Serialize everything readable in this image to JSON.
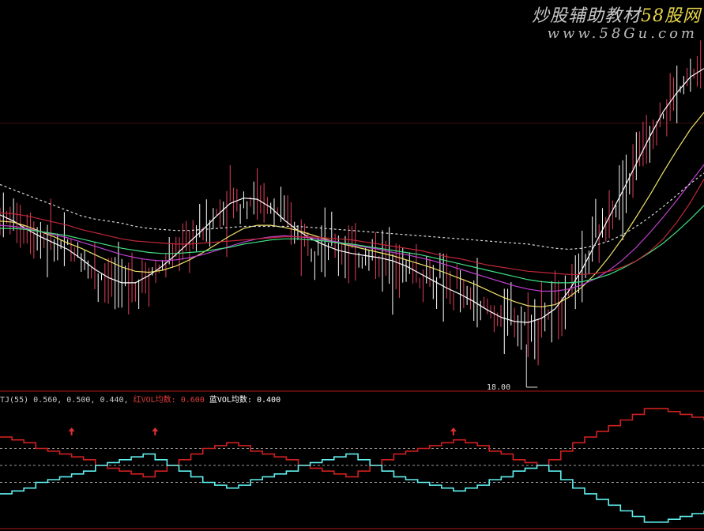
{
  "watermark": {
    "title_prefix": "炒股辅助教材",
    "title_brand": "58股网",
    "url": "www.58Gu.com"
  },
  "indicator": {
    "name": "TJ(55)",
    "values": "0.560, 0.500, 0.440,",
    "red_label": "红VOL均数:",
    "red_value": "0.600",
    "blue_label": "蓝VOL均数:",
    "blue_value": "0.400"
  },
  "colors": {
    "background": "#000000",
    "up_candle": "#ffffff",
    "down_candle": "#e0405e",
    "ma5": "#ffffff",
    "ma10": "#f0e26a",
    "ma20": "#c040d0",
    "ma30": "#40e080",
    "ma60": "#c02838",
    "ma120": "#d8d8d8",
    "indicator_red": "#d02020",
    "indicator_cyan": "#60f0f0",
    "panel_border": "#b01818"
  },
  "chart_data": [
    {
      "type": "candlestick",
      "low_label": "18.00",
      "grid": "horizontal",
      "series": [
        {
          "key": "ma5",
          "values": [
            31.6,
            31.0,
            30.2,
            29.5,
            28.9,
            28.3,
            27.4,
            26.4,
            25.6,
            25.1,
            25.1,
            25.8,
            26.7,
            27.8,
            29.0,
            30.2,
            31.5,
            32.7,
            33.2,
            33.1,
            32.3,
            31.1,
            30.1,
            29.3,
            28.7,
            28.2,
            27.9,
            27.7,
            27.5,
            27.2,
            26.7,
            26.0,
            25.3,
            24.6,
            24.0,
            23.3,
            22.5,
            21.8,
            21.4,
            21.3,
            21.7,
            22.6,
            24.3,
            26.4,
            28.9,
            31.4,
            33.9,
            36.5,
            39.1,
            41.5,
            43.3,
            44.8,
            45.6
          ]
        },
        {
          "key": "ma10",
          "values": [
            31.0,
            30.9,
            30.5,
            30.0,
            29.5,
            28.9,
            28.4,
            27.8,
            27.2,
            26.6,
            26.2,
            26.1,
            26.3,
            26.7,
            27.3,
            28.0,
            28.8,
            29.6,
            30.3,
            30.6,
            30.6,
            30.4,
            30.1,
            29.7,
            29.3,
            28.9,
            28.6,
            28.3,
            28.0,
            27.7,
            27.3,
            26.9,
            26.5,
            26.0,
            25.5,
            25.0,
            24.4,
            23.8,
            23.3,
            22.9,
            22.8,
            23.0,
            23.7,
            24.7,
            26.0,
            27.6,
            29.4,
            31.4,
            33.5,
            35.7,
            37.8,
            39.8,
            41.4
          ]
        },
        {
          "key": "ma20",
          "values": [
            30.6,
            30.5,
            30.3,
            30.0,
            29.7,
            29.4,
            29.0,
            28.6,
            28.2,
            27.8,
            27.5,
            27.3,
            27.2,
            27.3,
            27.5,
            27.8,
            28.2,
            28.6,
            29.0,
            29.3,
            29.5,
            29.6,
            29.5,
            29.4,
            29.2,
            29.0,
            28.7,
            28.5,
            28.3,
            28.0,
            27.8,
            27.5,
            27.2,
            26.8,
            26.4,
            26.0,
            25.6,
            25.2,
            24.8,
            24.5,
            24.3,
            24.3,
            24.5,
            24.9,
            25.5,
            26.3,
            27.3,
            28.5,
            29.9,
            31.4,
            33.0,
            34.7,
            36.4
          ]
        },
        {
          "key": "ma30",
          "values": [
            30.3,
            30.3,
            30.2,
            30.0,
            29.8,
            29.6,
            29.3,
            29.0,
            28.7,
            28.4,
            28.2,
            28.0,
            27.9,
            27.9,
            28.0,
            28.1,
            28.3,
            28.5,
            28.8,
            29.0,
            29.2,
            29.3,
            29.3,
            29.2,
            29.1,
            28.9,
            28.8,
            28.6,
            28.4,
            28.2,
            28.0,
            27.8,
            27.5,
            27.2,
            26.9,
            26.6,
            26.3,
            26.0,
            25.7,
            25.4,
            25.2,
            25.1,
            25.1,
            25.2,
            25.5,
            25.9,
            26.5,
            27.2,
            28.0,
            28.9,
            30.0,
            31.2,
            32.5
          ]
        },
        {
          "key": "ma60",
          "values": [
            31.8,
            31.7,
            31.5,
            31.2,
            30.9,
            30.6,
            30.2,
            29.9,
            29.6,
            29.3,
            29.1,
            29.0,
            28.9,
            28.8,
            28.8,
            28.9,
            29.0,
            29.1,
            29.2,
            29.3,
            29.4,
            29.5,
            29.5,
            29.5,
            29.4,
            29.3,
            29.2,
            29.0,
            28.8,
            28.6,
            28.4,
            28.2,
            27.9,
            27.6,
            27.4,
            27.1,
            26.8,
            26.6,
            26.4,
            26.2,
            26.1,
            26.0,
            25.9,
            25.9,
            26.0,
            26.2,
            26.6,
            27.2,
            28.1,
            29.3,
            30.9,
            32.8,
            35.0
          ]
        },
        {
          "key": "ma120",
          "values": [
            34.5,
            34.0,
            33.5,
            33.0,
            32.5,
            32.0,
            31.5,
            31.2,
            31.0,
            30.8,
            30.5,
            30.3,
            30.2,
            30.1,
            30.1,
            30.2,
            30.3,
            30.4,
            30.5,
            30.5,
            30.5,
            30.5,
            30.5,
            30.4,
            30.3,
            30.2,
            30.1,
            30.0,
            29.9,
            29.8,
            29.7,
            29.6,
            29.5,
            29.4,
            29.3,
            29.2,
            29.1,
            29.0,
            28.9,
            28.8,
            28.6,
            28.4,
            28.3,
            28.4,
            28.7,
            29.1,
            29.7,
            30.5,
            31.4,
            32.4,
            33.5,
            34.6,
            35.6
          ]
        }
      ]
    },
    {
      "type": "line",
      "name": "TJ(55)",
      "levels": [
        0.56,
        0.5,
        0.44
      ],
      "series": [
        {
          "key": "red",
          "name": "红VOL均数",
          "values": [
            0.6,
            0.59,
            0.58,
            0.56,
            0.55,
            0.54,
            0.53,
            0.52,
            0.5,
            0.49,
            0.48,
            0.47,
            0.46,
            0.48,
            0.5,
            0.52,
            0.54,
            0.56,
            0.57,
            0.58,
            0.57,
            0.55,
            0.54,
            0.53,
            0.52,
            0.5,
            0.49,
            0.48,
            0.47,
            0.46,
            0.48,
            0.5,
            0.52,
            0.54,
            0.55,
            0.56,
            0.57,
            0.58,
            0.59,
            0.58,
            0.57,
            0.55,
            0.54,
            0.52,
            0.51,
            0.5,
            0.52,
            0.55,
            0.58,
            0.6,
            0.62,
            0.64,
            0.66,
            0.68,
            0.7,
            0.7,
            0.69,
            0.68,
            0.67,
            0.66
          ]
        },
        {
          "key": "cyan",
          "name": "蓝VOL均数",
          "values": [
            0.4,
            0.41,
            0.42,
            0.44,
            0.45,
            0.46,
            0.47,
            0.48,
            0.5,
            0.51,
            0.52,
            0.53,
            0.54,
            0.52,
            0.5,
            0.48,
            0.46,
            0.44,
            0.43,
            0.42,
            0.43,
            0.45,
            0.46,
            0.47,
            0.48,
            0.5,
            0.51,
            0.52,
            0.53,
            0.54,
            0.52,
            0.5,
            0.48,
            0.46,
            0.45,
            0.44,
            0.43,
            0.42,
            0.41,
            0.42,
            0.43,
            0.45,
            0.46,
            0.48,
            0.49,
            0.5,
            0.48,
            0.45,
            0.42,
            0.4,
            0.38,
            0.36,
            0.34,
            0.32,
            0.3,
            0.3,
            0.31,
            0.32,
            0.33,
            0.34
          ]
        }
      ],
      "signals": [
        6,
        13,
        38
      ]
    }
  ]
}
